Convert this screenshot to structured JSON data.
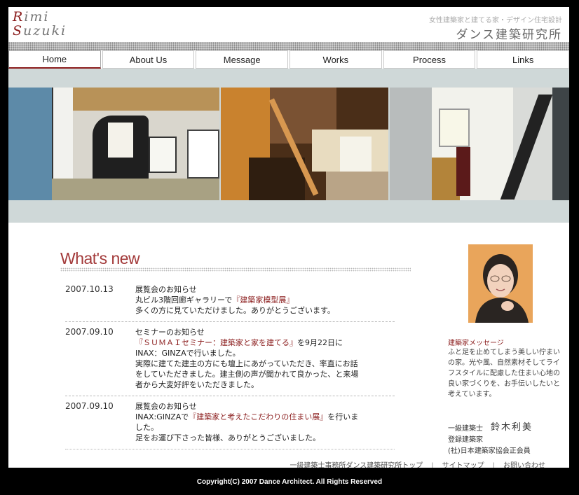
{
  "header": {
    "logo_line1_cap": "R",
    "logo_line1_rest": "imi",
    "logo_line2_cap": "S",
    "logo_line2_rest": "uzuki",
    "tagline": "女性建築家と建てる家・デザイン住宅設計",
    "company": "ダンス建築研究所"
  },
  "nav": {
    "items": [
      {
        "label": "Home",
        "active": true
      },
      {
        "label": "About Us"
      },
      {
        "label": "Message"
      },
      {
        "label": "Works"
      },
      {
        "label": "Process"
      },
      {
        "label": "Links"
      }
    ]
  },
  "main": {
    "title": "What's new",
    "news": [
      {
        "date": "2007.10.13",
        "heading": "展覧会のお知らせ",
        "pre": "丸ビル3階回廊ギャラリーで",
        "link": "『建築家模型展』",
        "post": "",
        "line3": "多くの方に見ていただけました。ありがとうございます。"
      },
      {
        "date": "2007.09.10",
        "heading": "セミナーのお知らせ",
        "link": "『ＳＵＭＡＩセミナー：建築家と家を建てる』",
        "post": "を9月22日に",
        "line3": "INAX：GINZAで行いました。",
        "line4": "実際に建てた建主の方にも壇上にあがっていただき、率直にお話",
        "line5": "をしていただきました。建主側の声が聞かれて良かった、と来場",
        "line6": "者から大変好評をいただきました。"
      },
      {
        "date": "2007.09.10",
        "heading": "展覧会のお知らせ",
        "pre": "INAX:GINZAで",
        "link": "『建築家と考えたこだわりの住まい展』",
        "post": "を行いま",
        "line3": "した。",
        "line4": "足をお運び下さった皆様、ありがとうございました。"
      }
    ]
  },
  "sidebar": {
    "title": "建築家メッセージ",
    "text": "ふと足を止めてしまう美しい佇まいの家。光や風、自然素材そしてライフスタイルに配慮した住まい心地の良い家づくりを、お手伝いしたいと考えています。",
    "role": "一級建築士",
    "name": "鈴木利美",
    "registration": "登録建築家",
    "association": "(社)日本建築家協会正会員"
  },
  "footer": {
    "link1": "一級建築士事務所ダンス建築研究所トップ",
    "link2": "サイトマップ",
    "link3": "お問い合わせ",
    "separator": "|",
    "copyright": "Copyright(C) 2007 Dance Architect. All Rights Reserved"
  },
  "colors": {
    "accent": "#8a1b1b",
    "background": "#000000",
    "band": "#cfd8d8"
  }
}
